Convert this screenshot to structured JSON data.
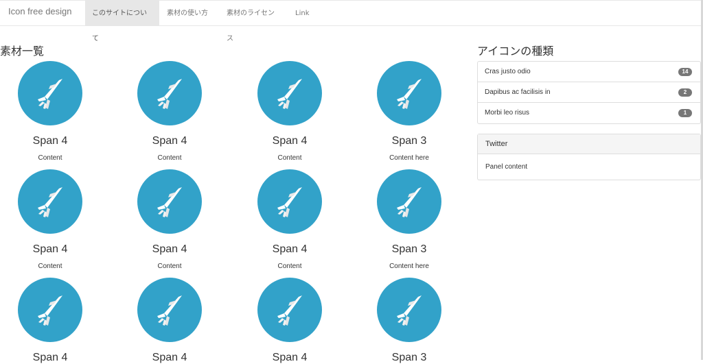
{
  "navbar": {
    "brand": "Icon free design",
    "items": [
      {
        "label": "このサイトについて",
        "active": true
      },
      {
        "label": "素材の使い方",
        "active": false
      },
      {
        "label": "素材のライセンス",
        "active": false
      },
      {
        "label": "Link",
        "active": false
      }
    ]
  },
  "main": {
    "title": "素材一覧",
    "rows": [
      [
        {
          "title": "Span 4",
          "content": "Content"
        },
        {
          "title": "Span 4",
          "content": "Content"
        },
        {
          "title": "Span 4",
          "content": "Content"
        },
        {
          "title": "Span 3",
          "content": "Content here"
        }
      ],
      [
        {
          "title": "Span 4",
          "content": "Content"
        },
        {
          "title": "Span 4",
          "content": "Content"
        },
        {
          "title": "Span 4",
          "content": "Content"
        },
        {
          "title": "Span 3",
          "content": "Content here"
        }
      ],
      [
        {
          "title": "Span 4",
          "content": ""
        },
        {
          "title": "Span 4",
          "content": ""
        },
        {
          "title": "Span 4",
          "content": ""
        },
        {
          "title": "Span 3",
          "content": ""
        }
      ]
    ],
    "icon_name": "jet-plane-icon",
    "icon_color": "#32a2c9"
  },
  "sidebar": {
    "title": "アイコンの種類",
    "list": [
      {
        "label": "Cras justo odio",
        "badge": "14"
      },
      {
        "label": "Dapibus ac facilisis in",
        "badge": "2"
      },
      {
        "label": "Morbi leo risus",
        "badge": "1"
      }
    ],
    "panel": {
      "heading": "Twitter",
      "body": "Panel content"
    }
  }
}
